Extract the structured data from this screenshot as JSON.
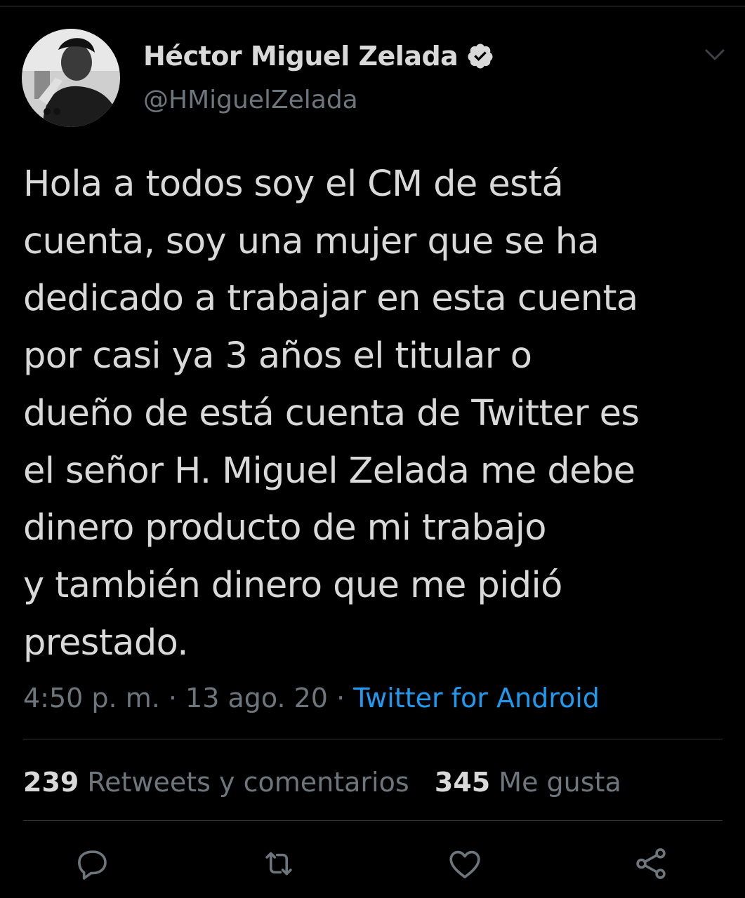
{
  "tweet": {
    "author": {
      "display_name": "Héctor Miguel Zelada",
      "handle": "@HMiguelZelada",
      "verified": true
    },
    "text": "Hola a todos soy el CM de está\ncuenta, soy una mujer que se ha\ndedicado a trabajar en esta cuenta\npor casi ya 3 años el titular o\ndueño de está cuenta de Twitter es\nel señor H. Miguel Zelada me debe\ndinero producto de mi trabajo\ny también dinero que me pidió\nprestado.",
    "time": "4:50 p. m.",
    "separator": " · ",
    "date": "13 ago. 20",
    "source": "Twitter for Android"
  },
  "stats": {
    "retweets_count": "239",
    "retweets_label": "Retweets y comentarios",
    "likes_count": "345",
    "likes_label": "Me gusta"
  },
  "icons": {
    "verified": "verified-badge-icon",
    "more": "chevron-down-icon",
    "reply": "reply-icon",
    "retweet": "retweet-icon",
    "like": "heart-icon",
    "share": "share-icon"
  },
  "colors": {
    "background": "#000000",
    "text": "#d9d9d9",
    "secondary": "#6e767d",
    "link": "#1d9bf0",
    "divider": "#2f3336"
  }
}
